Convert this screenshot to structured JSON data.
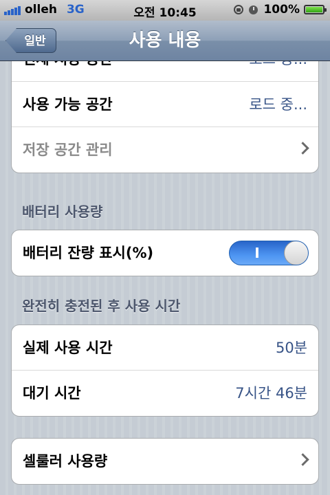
{
  "status": {
    "carrier": "olleh",
    "network": "3G",
    "time": "오전 10:45",
    "battery": "100%",
    "battery_level": 1.0
  },
  "nav": {
    "back_label": "일반",
    "title": "사용 내용"
  },
  "storage": {
    "rows": [
      {
        "label": "전체 저장 공간",
        "value": "로드 중..."
      },
      {
        "label": "사용 가능 공간",
        "value": "로드 중..."
      },
      {
        "label": "저장 공간 관리"
      }
    ]
  },
  "battery_section": {
    "header": "배터리 사용량",
    "percent_label": "배터리 잔량 표시(%)",
    "toggle_on_label": "I",
    "toggle_on": true
  },
  "usage_section": {
    "header": "완전히 충전된 후 사용 시간",
    "usage_label": "실제 사용 시간",
    "usage_value": "50분",
    "standby_label": "대기 시간",
    "standby_value": "7시간 46분"
  },
  "cellular": {
    "label": "셀룰러 사용량"
  },
  "icons": [
    "signal-icon",
    "rotation-lock-icon",
    "alarm-icon",
    "battery-icon",
    "chevron-right-icon"
  ],
  "colors": {
    "value_text": "#385487",
    "toggle_on": "#3f83e6",
    "section_header": "#4c566c"
  }
}
